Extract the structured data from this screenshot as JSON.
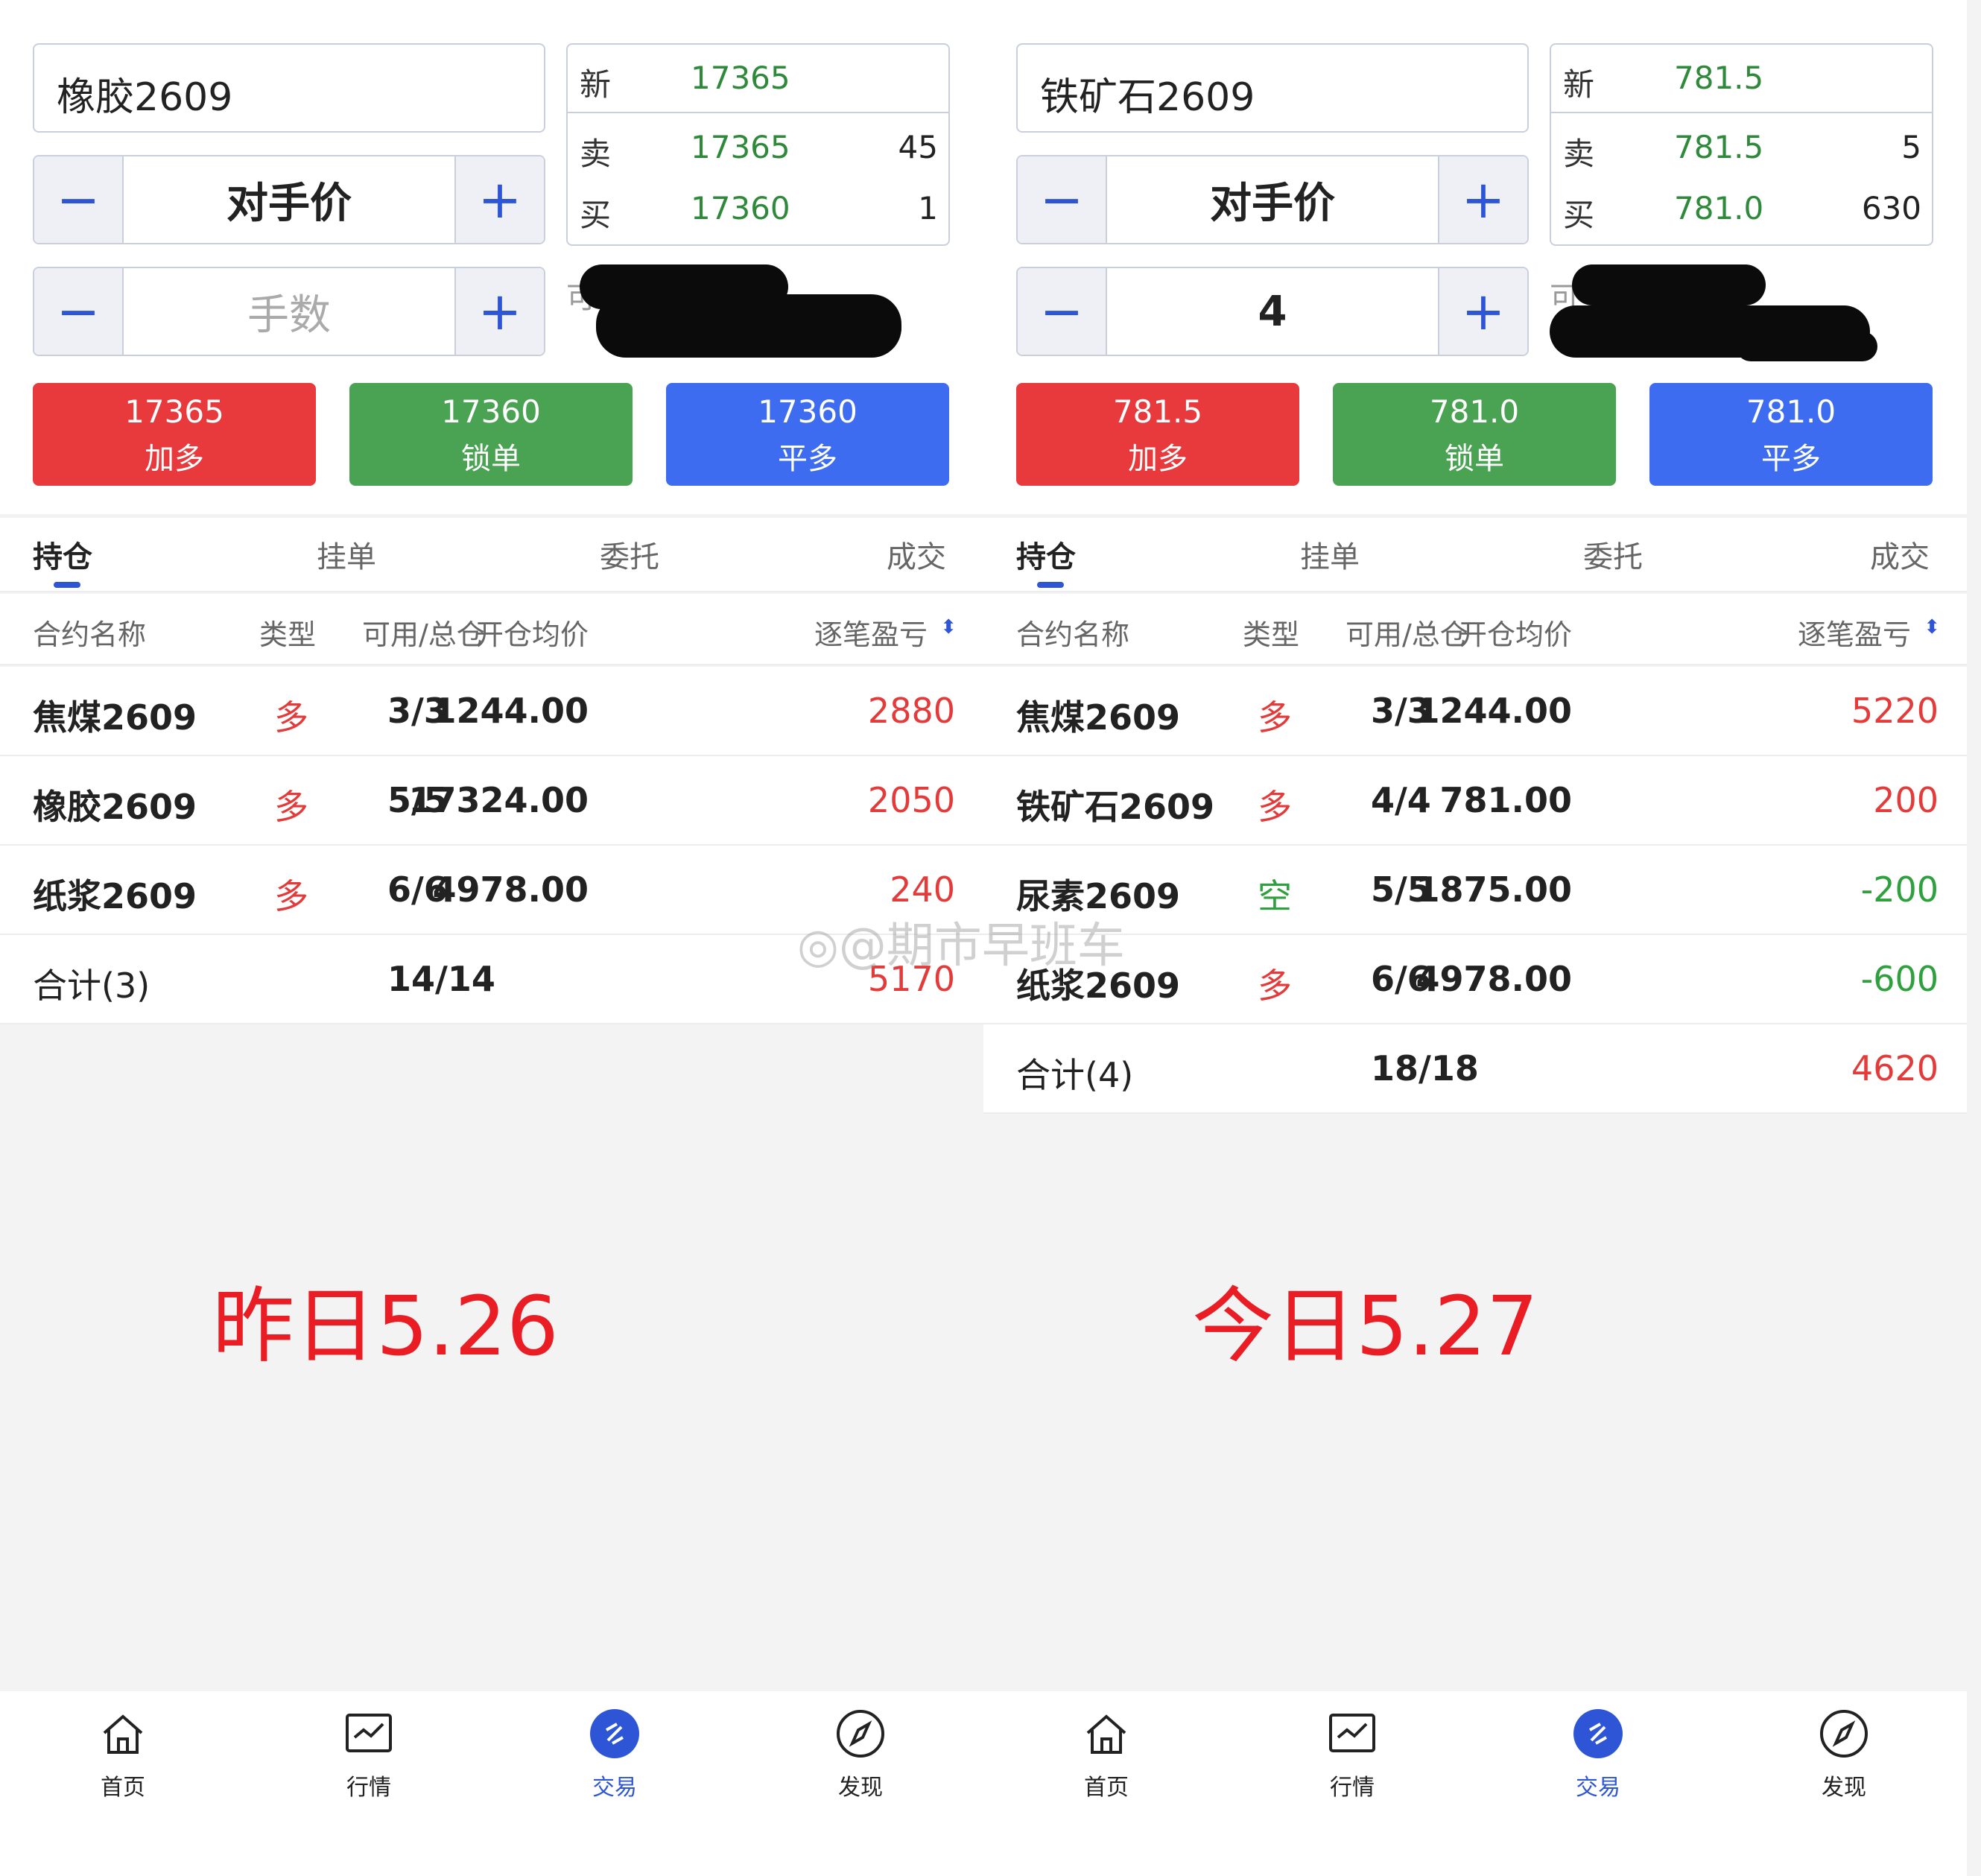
{
  "left": {
    "contract": "橡胶2609",
    "price_mode": "对手价",
    "qty_placeholder": "手数",
    "qty_value": "",
    "quote": {
      "new_label": "新",
      "new": "17365",
      "ask_label": "卖",
      "ask": "17365",
      "ask_vol": "45",
      "bid_label": "买",
      "bid": "17360",
      "bid_vol": "1"
    },
    "redacted_hint": "可",
    "actions": [
      {
        "price": "17365",
        "label": "加多"
      },
      {
        "price": "17360",
        "label": "锁单"
      },
      {
        "price": "17360",
        "label": "平多"
      }
    ],
    "tabs": [
      "持仓",
      "挂单",
      "委托",
      "成交"
    ],
    "headers": [
      "合约名称",
      "类型",
      "可用/总仓",
      "开仓均价",
      "逐笔盈亏"
    ],
    "rows": [
      {
        "name": "焦煤2609",
        "type": "多",
        "avail": "3/3",
        "avg": "1244.00",
        "pl": "2880",
        "dir": "long",
        "pl_sign": "pos"
      },
      {
        "name": "橡胶2609",
        "type": "多",
        "avail": "5/5",
        "avg": "17324.00",
        "pl": "2050",
        "dir": "long",
        "pl_sign": "pos"
      },
      {
        "name": "纸浆2609",
        "type": "多",
        "avail": "6/6",
        "avg": "4978.00",
        "pl": "240",
        "dir": "long",
        "pl_sign": "pos"
      }
    ],
    "total": {
      "name": "合计(3)",
      "avail": "14/14",
      "pl": "5170"
    },
    "caption": "昨日5.26"
  },
  "right": {
    "contract": "铁矿石2609",
    "price_mode": "对手价",
    "qty_placeholder": "",
    "qty_value": "4",
    "quote": {
      "new_label": "新",
      "new": "781.5",
      "ask_label": "卖",
      "ask": "781.5",
      "ask_vol": "5",
      "bid_label": "买",
      "bid": "781.0",
      "bid_vol": "630"
    },
    "redacted_hint": "可",
    "actions": [
      {
        "price": "781.5",
        "label": "加多"
      },
      {
        "price": "781.0",
        "label": "锁单"
      },
      {
        "price": "781.0",
        "label": "平多"
      }
    ],
    "tabs": [
      "持仓",
      "挂单",
      "委托",
      "成交"
    ],
    "headers": [
      "合约名称",
      "类型",
      "可用/总仓",
      "开仓均价",
      "逐笔盈亏"
    ],
    "rows": [
      {
        "name": "焦煤2609",
        "type": "多",
        "avail": "3/3",
        "avg": "1244.00",
        "pl": "5220",
        "dir": "long",
        "pl_sign": "pos"
      },
      {
        "name": "铁矿石2609",
        "type": "多",
        "avail": "4/4",
        "avg": "781.00",
        "pl": "200",
        "dir": "long",
        "pl_sign": "pos"
      },
      {
        "name": "尿素2609",
        "type": "空",
        "avail": "5/5",
        "avg": "1875.00",
        "pl": "-200",
        "dir": "short",
        "pl_sign": "neg"
      },
      {
        "name": "纸浆2609",
        "type": "多",
        "avail": "6/6",
        "avg": "4978.00",
        "pl": "-600",
        "dir": "long",
        "pl_sign": "neg"
      }
    ],
    "total": {
      "name": "合计(4)",
      "avail": "18/18",
      "pl": "4620"
    },
    "caption": "今日5.27"
  },
  "nav": [
    {
      "label": "首页",
      "icon": "home-icon"
    },
    {
      "label": "行情",
      "icon": "chart-icon"
    },
    {
      "label": "交易",
      "icon": "trade-icon"
    },
    {
      "label": "发现",
      "icon": "compass-icon"
    }
  ],
  "nav_active": "交易",
  "watermark": "@期市早班车",
  "colors": {
    "accent": "#2d55d6",
    "red": "#e33a3a",
    "green": "#2ea03d",
    "caption": "#ea1c24"
  }
}
